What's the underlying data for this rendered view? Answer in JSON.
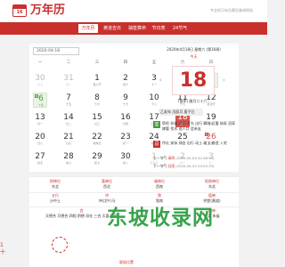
{
  "header": {
    "logo_num": "16",
    "logo_text": "万年历",
    "slogan": "专业的万年历黄历查询网站"
  },
  "nav": {
    "items": [
      "万年历",
      "黄道吉日",
      "抽签算命",
      "节日表",
      "24节气"
    ]
  },
  "calendar": {
    "date_select": "2020-04-18",
    "weekdays": [
      "一",
      "二",
      "三",
      "四",
      "五",
      "六",
      "日"
    ],
    "rows": [
      [
        {
          "d": "30",
          "l": "初七",
          "t": "dim"
        },
        {
          "d": "31",
          "l": "初八",
          "t": "dim"
        },
        {
          "d": "1",
          "l": "愚人节",
          "t": ""
        },
        {
          "d": "2",
          "l": "初十",
          "t": ""
        },
        {
          "d": "3",
          "l": "十一",
          "t": ""
        },
        {
          "d": "4",
          "l": "清明",
          "t": "holiday",
          "b": "休"
        },
        {
          "d": "5",
          "l": "十三",
          "t": "holiday",
          "b": "休"
        }
      ],
      [
        {
          "d": "6",
          "l": "十四",
          "t": "holiday",
          "b": "休"
        },
        {
          "d": "7",
          "l": "十五",
          "t": ""
        },
        {
          "d": "8",
          "l": "十六",
          "t": ""
        },
        {
          "d": "9",
          "l": "十七",
          "t": ""
        },
        {
          "d": "10",
          "l": "十八",
          "t": ""
        },
        {
          "d": "11",
          "l": "十九",
          "t": ""
        },
        {
          "d": "12",
          "l": "复活节",
          "t": ""
        }
      ],
      [
        {
          "d": "13",
          "l": "廿一",
          "t": ""
        },
        {
          "d": "14",
          "l": "廿二",
          "t": ""
        },
        {
          "d": "15",
          "l": "廿三",
          "t": ""
        },
        {
          "d": "16",
          "l": "廿四",
          "t": ""
        },
        {
          "d": "17",
          "l": "廿五",
          "t": ""
        },
        {
          "d": "18",
          "l": "廿六",
          "t": "today"
        },
        {
          "d": "19",
          "l": "谷雨",
          "t": ""
        }
      ],
      [
        {
          "d": "20",
          "l": "廿八",
          "t": ""
        },
        {
          "d": "21",
          "l": "廿九",
          "t": ""
        },
        {
          "d": "22",
          "l": "地球日",
          "t": ""
        },
        {
          "d": "23",
          "l": "初一",
          "t": ""
        },
        {
          "d": "24",
          "l": "初二",
          "t": ""
        },
        {
          "d": "25",
          "l": "初三",
          "t": ""
        },
        {
          "d": "26",
          "l": "初四",
          "t": "redday",
          "b": "班"
        }
      ],
      [
        {
          "d": "27",
          "l": "初五",
          "t": ""
        },
        {
          "d": "28",
          "l": "初六",
          "t": ""
        },
        {
          "d": "29",
          "l": "初七",
          "t": ""
        },
        {
          "d": "30",
          "l": "初八",
          "t": ""
        },
        {
          "d": "1",
          "l": "劳动节",
          "t": "dim"
        },
        {
          "d": "2",
          "l": "初十",
          "t": "dim"
        },
        {
          "d": "3",
          "l": "十一",
          "t": "dim"
        }
      ]
    ]
  },
  "panel": {
    "head": "2020年4月18日 星期六 (第16周)",
    "today": "今天",
    "big_day": "18",
    "prev": "‹",
    "next": "›",
    "ganzhi": "(鼠年) 腊月二十六 ·",
    "pill": "乙亥年 戊辰月 庚子日",
    "yi_tag": "宜",
    "yi_text": "祭祀 祈福 求嗣 开光 出行 解除 订盟 纳采 冠笄 嫁娶 伐木 进人口 会亲友",
    "ji_tag": "忌",
    "ji_text": "作灶 安床 开仓 出行 动土 破土 修造 入宅",
    "prev_term_label": "上一节气",
    "prev_term_name": "清明",
    "prev_term_date": "(2020-04-04 20:48:34)",
    "next_term_label": "下一节气",
    "next_term_name": "谷雨",
    "next_term_date": "(2020-04-20 03:53:33)"
  },
  "info": {
    "row1": [
      {
        "lbl": "财神位",
        "val": "东北"
      },
      {
        "lbl": "喜神位",
        "val": "西北"
      },
      {
        "lbl": "福神位",
        "val": "西南"
      },
      {
        "lbl": "阳贵神位",
        "val": "东北"
      }
    ],
    "row2": [
      {
        "lbl": "五行",
        "val": "沙中土"
      },
      {
        "lbl": "冲",
        "val": "冲(戊午)马"
      },
      {
        "lbl": "煞",
        "val": "煞南"
      },
      {
        "lbl": "值神",
        "val": "明堂(黄道)"
      }
    ],
    "row3": [
      {
        "lbl": "宜",
        "val": "天德合 月德合 四相 阴德 母仓 三合 天喜 天医"
      },
      {
        "lbl": "凶神",
        "val": "五离 朱雀"
      }
    ],
    "left_edge": "1\n十",
    "bottom": "星辰位置"
  },
  "watermark": "东坡收录网"
}
